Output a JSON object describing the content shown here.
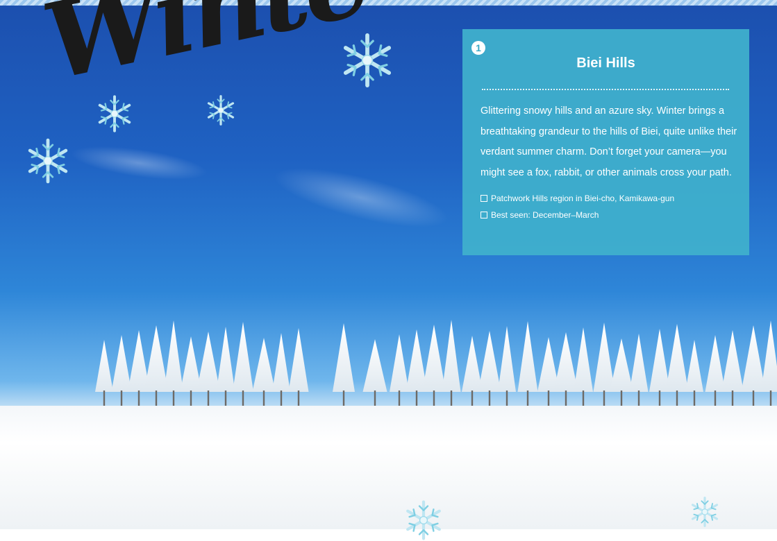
{
  "page": {
    "title_script": "Winte"
  },
  "card": {
    "number": "1",
    "title": "Biei Hills",
    "description": "Glittering snowy hills and an azure sky. Winter brings a breathtaking grandeur to the hills of Biei, quite unlike their verdant summer charm. Don’t forget your camera—you might see a fox, rabbit, or other animals cross your path.",
    "details": [
      "Patchwork Hills region in Biei-cho, Kamikawa-gun",
      "Best seen: December–March"
    ]
  },
  "colors": {
    "sky_top": "#1c4fae",
    "sky_bottom": "#6fb6ec",
    "card_bg": "#40b0cc",
    "title_ink": "#1a1a1a",
    "snow": "#ffffff"
  },
  "icons": {
    "snowflake": "snowflake-icon",
    "checkbox": "checkbox-icon"
  }
}
